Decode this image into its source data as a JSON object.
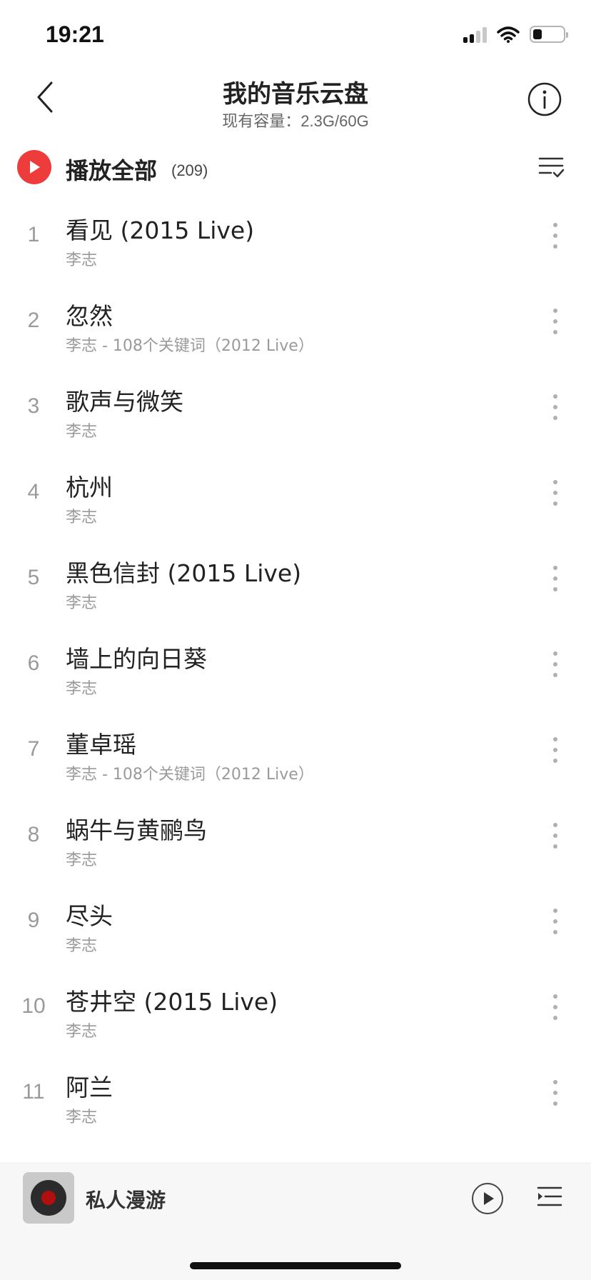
{
  "status": {
    "time": "19:21"
  },
  "header": {
    "title": "我的音乐云盘",
    "subtitle": "现有容量：2.3G/60G"
  },
  "playall": {
    "label": "播放全部",
    "count": "(209)"
  },
  "songs": [
    {
      "index": "1",
      "title": "看见 (2015 Live)",
      "artist": "李志"
    },
    {
      "index": "2",
      "title": "忽然",
      "artist": "李志 - 108个关键词（2012 Live）"
    },
    {
      "index": "3",
      "title": "歌声与微笑",
      "artist": "李志"
    },
    {
      "index": "4",
      "title": "杭州",
      "artist": "李志"
    },
    {
      "index": "5",
      "title": "黑色信封 (2015 Live)",
      "artist": "李志"
    },
    {
      "index": "6",
      "title": "墙上的向日葵",
      "artist": "李志"
    },
    {
      "index": "7",
      "title": "董卓瑶",
      "artist": "李志 - 108个关键词（2012 Live）"
    },
    {
      "index": "8",
      "title": "蜗牛与黄鹂鸟",
      "artist": "李志"
    },
    {
      "index": "9",
      "title": "尽头",
      "artist": "李志"
    },
    {
      "index": "10",
      "title": "苍井空 (2015 Live)",
      "artist": "李志"
    },
    {
      "index": "11",
      "title": "阿兰",
      "artist": "李志"
    }
  ],
  "player": {
    "title": "私人漫游"
  },
  "colors": {
    "accent": "#ee3b3b"
  },
  "icons": {
    "back": "chevron-left-icon",
    "info": "info-icon",
    "play_all": "play-circle-icon",
    "multiselect": "list-check-icon",
    "more": "more-vertical-icon",
    "player_play": "play-icon",
    "playlist": "playlist-icon"
  }
}
